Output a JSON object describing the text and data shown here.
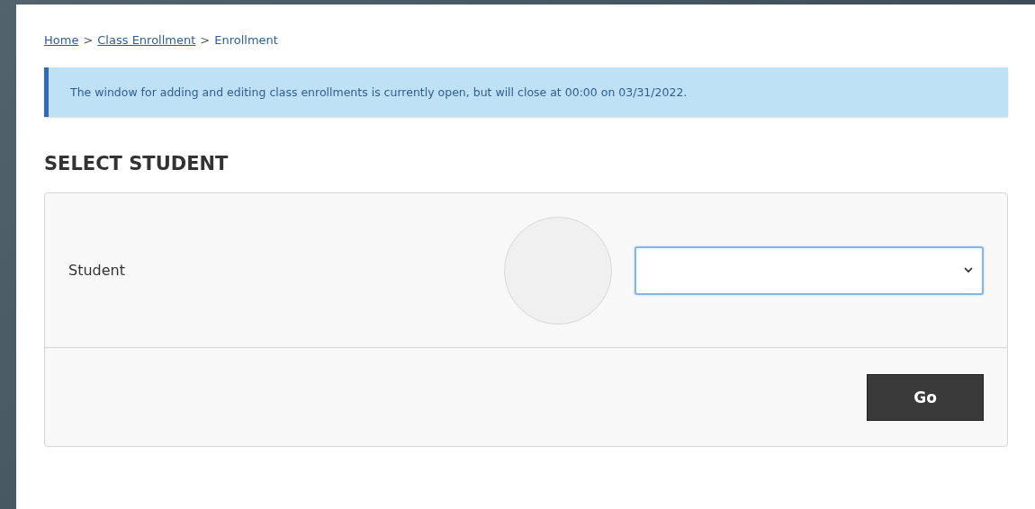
{
  "breadcrumb": [
    {
      "kind": "link",
      "label": "Home"
    },
    {
      "kind": "separator",
      "label": ">"
    },
    {
      "kind": "link",
      "label": "Class Enrollment"
    },
    {
      "kind": "separator",
      "label": ">"
    },
    {
      "kind": "current",
      "label": "Enrollment"
    }
  ],
  "notice": {
    "text": "The window for adding and editing class enrollments is currently open, but will close at 00:00 on 03/31/2022."
  },
  "heading": "SELECT STUDENT",
  "form": {
    "field_label": "Student",
    "select": {
      "focused": true
    },
    "avatar": {
      "kind": "placeholder"
    },
    "button": "Go"
  }
}
